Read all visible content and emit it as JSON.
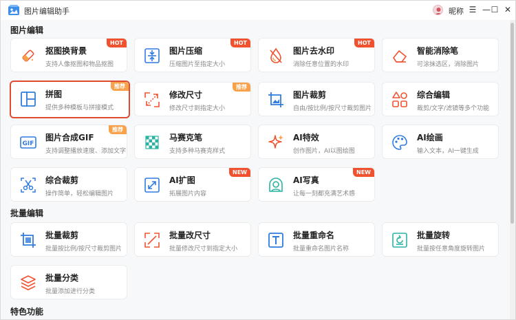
{
  "app": {
    "title": "图片编辑助手",
    "username": "昵称"
  },
  "window_controls": {
    "menu": "☰",
    "minimize": "—",
    "maximize": "☐",
    "close": "✕"
  },
  "sections": {
    "edit": "图片编辑",
    "batch": "批量编辑",
    "special": "特色功能"
  },
  "edit_tools": [
    {
      "name": "抠图换背景",
      "desc": "支持人像抠图和物品抠图",
      "badge": "HOT",
      "icon": "eraser-icon"
    },
    {
      "name": "图片压缩",
      "desc": "压缩图片至指定大小",
      "badge": "HOT",
      "icon": "compress-icon"
    },
    {
      "name": "图片去水印",
      "desc": "消除任意位置的水印",
      "badge": "HOT",
      "icon": "drop-icon"
    },
    {
      "name": "智能消除笔",
      "desc": "可涂抹选区，消除图片",
      "badge": "",
      "icon": "eraser-pen-icon"
    },
    {
      "name": "拼图",
      "desc": "提供多种模板与拼接模式",
      "badge": "推荐",
      "icon": "collage-icon"
    },
    {
      "name": "修改尺寸",
      "desc": "修改尺寸到指定大小",
      "badge": "推荐",
      "icon": "resize-icon"
    },
    {
      "name": "图片裁剪",
      "desc": "自由/按比例/按尺寸裁剪图片",
      "badge": "",
      "icon": "crop-icon"
    },
    {
      "name": "综合编辑",
      "desc": "裁剪/文字/滤镜等多个功能",
      "badge": "",
      "icon": "shapes-icon"
    },
    {
      "name": "图片合成GIF",
      "desc": "支持调整播放速度、添加文字",
      "badge": "推荐",
      "icon": "gif-icon"
    },
    {
      "name": "马赛克笔",
      "desc": "支持多种马赛克样式",
      "badge": "",
      "icon": "mosaic-icon"
    },
    {
      "name": "AI特效",
      "desc": "创作图片，AI以图绘图",
      "badge": "",
      "icon": "sparkle-icon"
    },
    {
      "name": "AI绘画",
      "desc": "输入文本，AI一键生成",
      "badge": "",
      "icon": "palette-icon"
    },
    {
      "name": "综合裁剪",
      "desc": "操作简单，轻松编辑图片",
      "badge": "",
      "icon": "scissors-icon"
    },
    {
      "name": "AI扩图",
      "desc": "拓展图片内容",
      "badge": "NEW",
      "icon": "expand-icon"
    },
    {
      "name": "AI写真",
      "desc": "让每一刻都充满艺术感",
      "badge": "NEW",
      "icon": "portrait-icon"
    }
  ],
  "batch_tools": [
    {
      "name": "批量裁剪",
      "desc": "批量按比例/按尺寸裁剪图片",
      "icon": "batch-crop-icon"
    },
    {
      "name": "批量改尺寸",
      "desc": "批量修改尺寸到指定大小",
      "icon": "batch-resize-icon"
    },
    {
      "name": "批量重命名",
      "desc": "批量重命名图片名称",
      "icon": "rename-icon"
    },
    {
      "name": "批量旋转",
      "desc": "批量按任意角度旋转图片",
      "icon": "rotate-icon"
    },
    {
      "name": "批量分类",
      "desc": "批量添加进行分类",
      "icon": "layers-icon"
    }
  ],
  "colors": {
    "accent": "#2f7be0",
    "hot": "#f0522f",
    "recommend": "#f7a14a",
    "selected_border": "#e04a2f"
  }
}
